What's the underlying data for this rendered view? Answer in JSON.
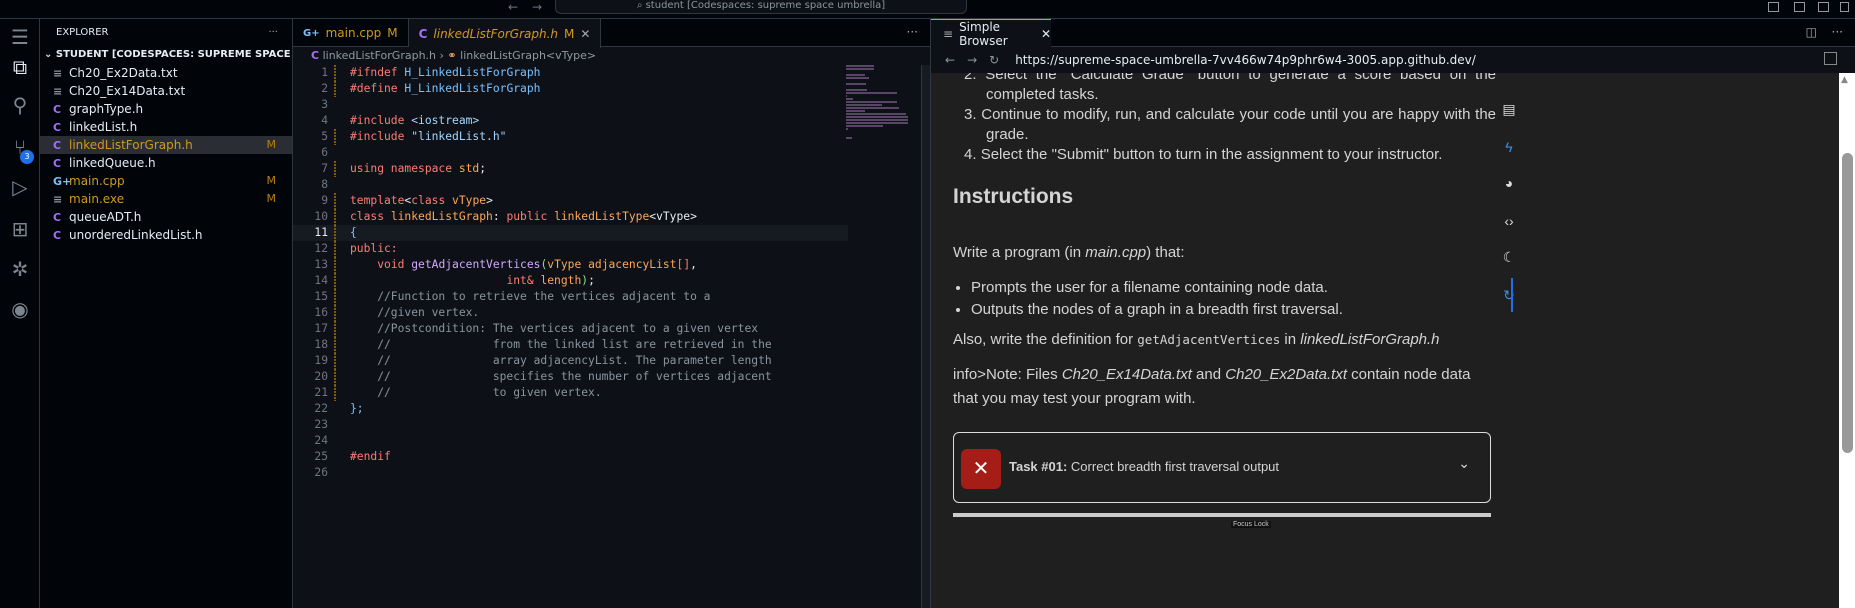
{
  "titlebar": {
    "command_center": "student [Codespaces: supreme space umbrella]"
  },
  "activity": {
    "scm_badge": "3"
  },
  "explorer": {
    "title": "EXPLORER",
    "root": "STUDENT [CODESPACES: SUPREME SPACE UMBREL...",
    "files": [
      {
        "name": "Ch20_Ex2Data.txt",
        "icon": "≡",
        "status": ""
      },
      {
        "name": "Ch20_Ex14Data.txt",
        "icon": "≡",
        "status": ""
      },
      {
        "name": "graphType.h",
        "icon": "C",
        "status": ""
      },
      {
        "name": "linkedList.h",
        "icon": "C",
        "status": ""
      },
      {
        "name": "linkedListForGraph.h",
        "icon": "C",
        "status": "M"
      },
      {
        "name": "linkedQueue.h",
        "icon": "C",
        "status": ""
      },
      {
        "name": "main.cpp",
        "icon": "G+",
        "status": "M"
      },
      {
        "name": "main.exe",
        "icon": "≡",
        "status": "M"
      },
      {
        "name": "queueADT.h",
        "icon": "C",
        "status": ""
      },
      {
        "name": "unorderedLinkedList.h",
        "icon": "C",
        "status": ""
      }
    ],
    "selected": "linkedListForGraph.h"
  },
  "editor": {
    "tabs": [
      {
        "label": "main.cpp",
        "status": "M"
      },
      {
        "label": "linkedListForGraph.h",
        "status": "M"
      }
    ],
    "breadcrumb": [
      "linkedListForGraph.h",
      "linkedListGraph<vType>"
    ],
    "current_line": 11,
    "lines": [
      [
        [
          "k",
          "#ifndef "
        ],
        [
          "b",
          "H_LinkedListForGraph"
        ]
      ],
      [
        [
          "k",
          "#define "
        ],
        [
          "b",
          "H_LinkedListForGraph"
        ]
      ],
      [],
      [
        [
          "k",
          "#include "
        ],
        [
          "s",
          "<iostream>"
        ]
      ],
      [
        [
          "k",
          "#include "
        ],
        [
          "s",
          "\"linkedList.h\""
        ]
      ],
      [],
      [
        [
          "k",
          "using namespace "
        ],
        [
          "o",
          "std"
        ],
        [
          "w",
          ";"
        ]
      ],
      [],
      [
        [
          "k",
          "template"
        ],
        [
          "w",
          "<"
        ],
        [
          "k",
          "class "
        ],
        [
          "o",
          "vType"
        ],
        [
          "w",
          ">"
        ]
      ],
      [
        [
          "k",
          "class "
        ],
        [
          "o",
          "linkedListGraph"
        ],
        [
          "w",
          ": "
        ],
        [
          "k",
          "public "
        ],
        [
          "o",
          "linkedListType"
        ],
        [
          "w",
          "<vType>"
        ]
      ],
      [
        [
          "b",
          "{"
        ]
      ],
      [
        [
          "k",
          "public:"
        ]
      ],
      [
        [
          "w",
          "    "
        ],
        [
          "k",
          "void "
        ],
        [
          "p",
          "getAdjacentVertices"
        ],
        [
          "g",
          "("
        ],
        [
          "o",
          "vType adjacencyList"
        ],
        [
          "k",
          "[]"
        ],
        [
          "w",
          ","
        ]
      ],
      [
        [
          "w",
          "                       "
        ],
        [
          "k",
          "int& "
        ],
        [
          "o",
          "length"
        ],
        [
          "g",
          ")"
        ],
        [
          "w",
          ";"
        ]
      ],
      [
        [
          "c",
          "    //Function to retrieve the vertices adjacent to a"
        ]
      ],
      [
        [
          "c",
          "    //given vertex."
        ]
      ],
      [
        [
          "c",
          "    //Postcondition: The vertices adjacent to a given vertex"
        ]
      ],
      [
        [
          "c",
          "    //               from the linked list are retrieved in the"
        ]
      ],
      [
        [
          "c",
          "    //               array adjacencyList. The parameter length"
        ]
      ],
      [
        [
          "c",
          "    //               specifies the number of vertices adjacent"
        ]
      ],
      [
        [
          "c",
          "    //               to given vertex."
        ]
      ],
      [
        [
          "b",
          "};"
        ]
      ],
      [],
      [],
      [
        [
          "k",
          "#endif"
        ]
      ],
      []
    ]
  },
  "browser": {
    "tab_label": "Simple Browser",
    "url": "https://supreme-space-umbrella-7vv466w74p9phr6w4-3005.app.github.dev/",
    "steps": [
      {
        "num": "2.",
        "text": "Select the \"Calculate Grade\" button to generate a score based on the completed tasks."
      },
      {
        "num": "3.",
        "text": "Continue to modify, run, and calculate your code until you are happy with the grade."
      },
      {
        "num": "4.",
        "text": "Select the \"Submit\" button to turn in the assignment to your instructor."
      }
    ],
    "heading": "Instructions",
    "intro_pre": "Write a program (in ",
    "intro_file": "main.cpp",
    "intro_post": ") that:",
    "bullets": [
      "Prompts the user for a filename containing node data.",
      "Outputs the nodes of a graph in a breadth first traversal."
    ],
    "also_pre": "Also, write the definition for ",
    "also_code": "getAdjacentVertices",
    "also_mid": " in ",
    "also_file": "linkedListForGraph.h",
    "note_pre": "info>Note: Files ",
    "note_f1": "Ch20_Ex14Data.txt",
    "note_mid": " and ",
    "note_f2": "Ch20_Ex2Data.txt",
    "note_post": " contain node data that you may test your program with.",
    "task": {
      "label": "Task #01:",
      "text": "Correct breadth first traversal output",
      "status": "failed"
    },
    "focus_lock": "Focus  Lock"
  }
}
